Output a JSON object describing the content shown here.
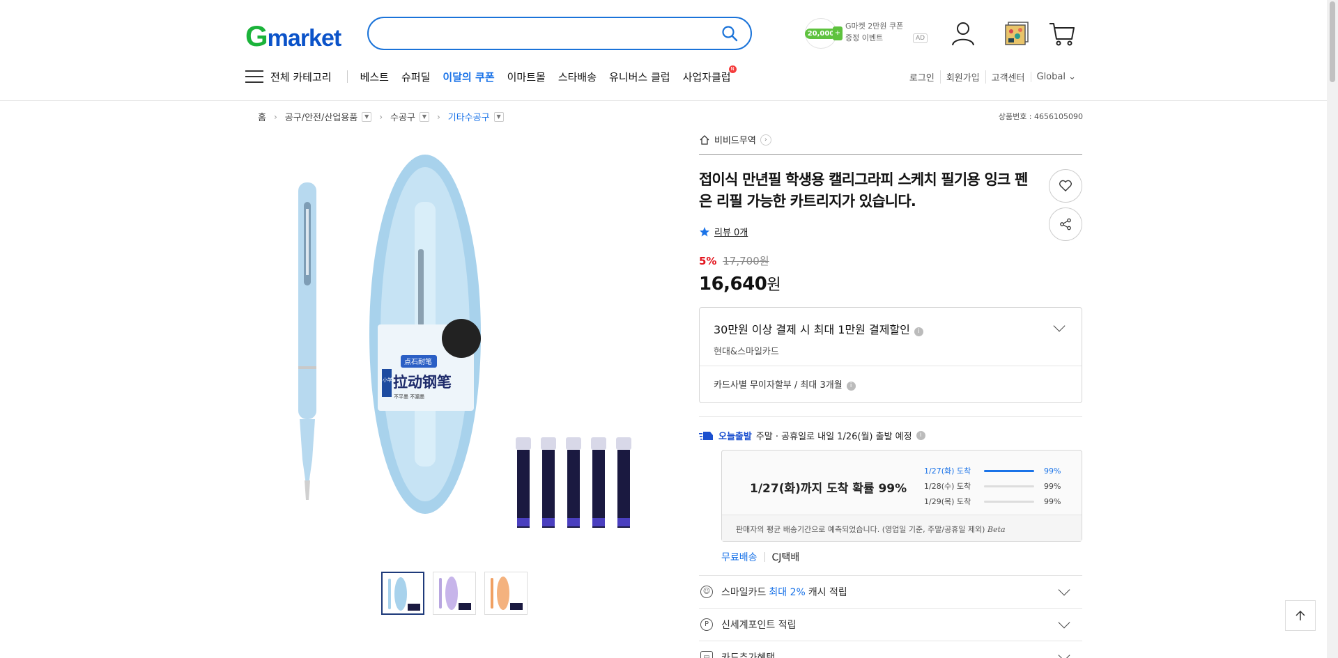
{
  "header": {
    "logo_g": "G",
    "logo_rest": "market",
    "search_placeholder": "",
    "coupon": {
      "amount": "20,000",
      "plus": "+",
      "line1": "G마켓 2만원 쿠폰",
      "line2": "증정 이벤트",
      "ad": "AD"
    }
  },
  "nav": {
    "all_categories": "전체 카테고리",
    "items": [
      "베스트",
      "슈퍼딜",
      "이달의 쿠폰",
      "이마트몰",
      "스타배송",
      "유니버스 클럽",
      "사업자클럽"
    ],
    "new_badge": "N",
    "util": [
      "로그인",
      "회원가입",
      "고객센터",
      "Global ⌄"
    ]
  },
  "breadcrumb": {
    "items": [
      "홈",
      "공구/안전/산업용품",
      "수공구",
      "기타수공구"
    ],
    "product_no": "상품번호 : 4656105090"
  },
  "product": {
    "seller": "비비드무역",
    "title": "접이식 만년필 학생용 캘리그라피 스케치 필기용 잉크 펜은 리필 가능한 카트리지가 있습니다.",
    "review": "리뷰 0개",
    "discount": "5%",
    "original_price": "17,700원",
    "price": "16,640",
    "price_unit": "원",
    "package_label": "拉动钢笔",
    "package_tag": "点石耐笔",
    "package_side": "小学生",
    "package_sub": "不平墨 不漏墨"
  },
  "card_offer": {
    "title": "30만원 이상 결제 시 최대 1만원 결제할인",
    "sub": "현대&스마일카드",
    "installment": "카드사별 무이자할부 / 최대 3개월",
    "info": "i"
  },
  "delivery": {
    "today_label": "오늘출발",
    "schedule": "주말 · 공휴일로 내일 1/26(월) 출발 예정",
    "headline": "1/27(화)까지 도착 확률 99%",
    "rows": [
      {
        "date": "1/27(화) 도착",
        "pct": "99%",
        "fill": 0.99
      },
      {
        "date": "1/28(수) 도착",
        "pct": "99%",
        "fill": 0.0
      },
      {
        "date": "1/29(목) 도착",
        "pct": "99%",
        "fill": 0.0
      }
    ],
    "note": "판매자의 평균 배송기간으로 예측되었습니다. (영업일 기준, 주말/공휴일 제외)",
    "beta": "Beta",
    "free": "무료배송",
    "carrier": "CJ택배"
  },
  "benefits": {
    "smile_pre": "스마일카드",
    "smile_blue": "최대 2%",
    "smile_post": "캐시 적립",
    "shinsegae": "신세계포인트 적립",
    "card_extra": "카드추가혜택"
  }
}
